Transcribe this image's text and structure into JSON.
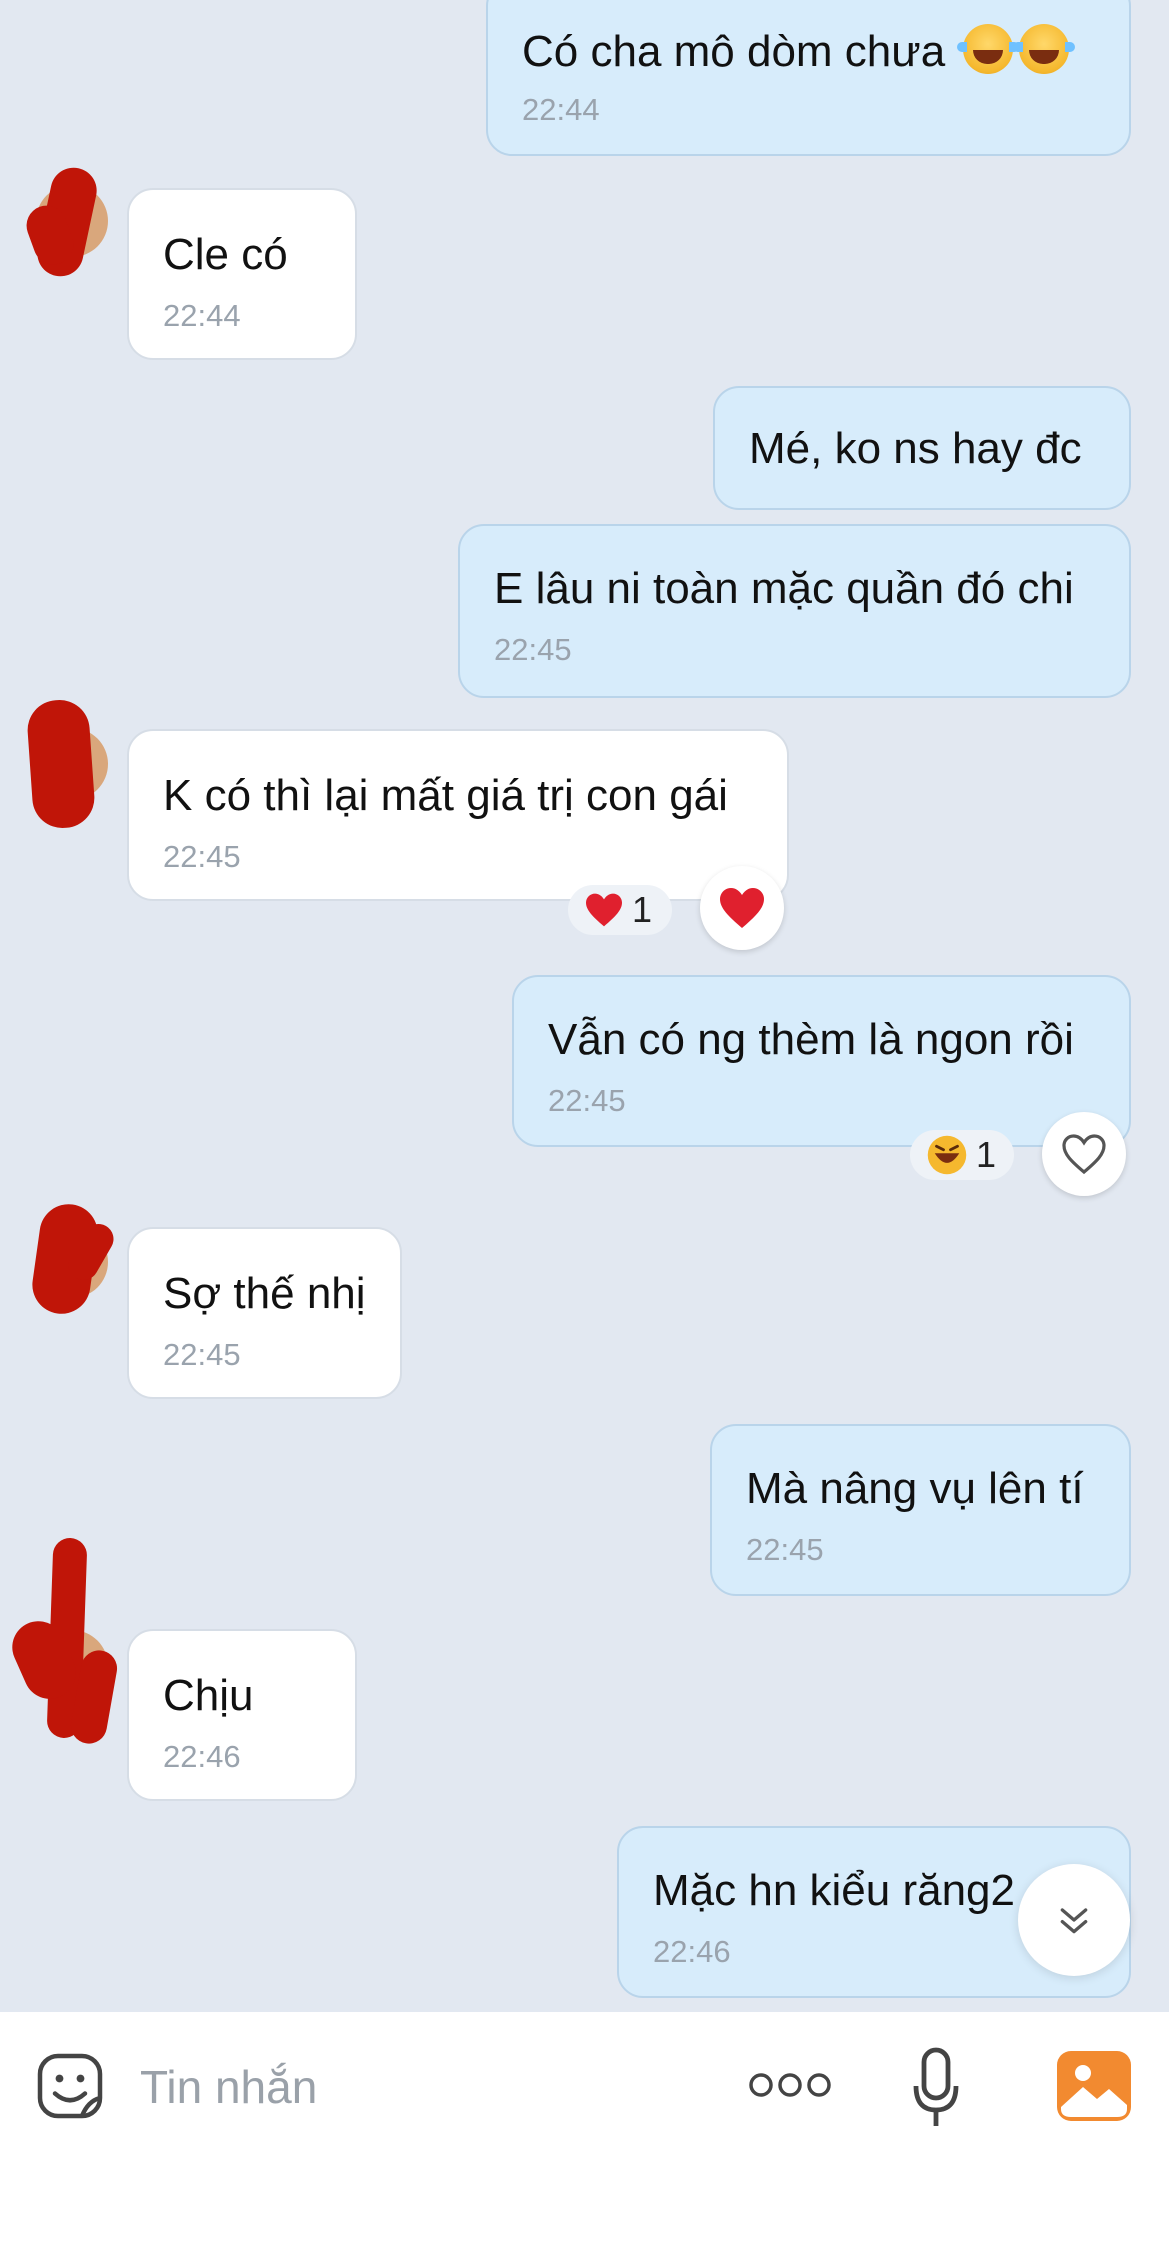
{
  "messages": [
    {
      "id": "m1",
      "side": "out",
      "text": "Có cha mô dòm chưa",
      "emoji_suffix": [
        "laughing-tears",
        "laughing-tears"
      ],
      "time": "22:44"
    },
    {
      "id": "m2",
      "side": "in",
      "text": "Cle có",
      "time": "22:44"
    },
    {
      "id": "m3",
      "side": "out",
      "text": "Mé, ko ns hay đc",
      "time": ""
    },
    {
      "id": "m4",
      "side": "out",
      "text": "E lâu ni toàn mặc quần đó chi",
      "time": "22:45"
    },
    {
      "id": "m5",
      "side": "in",
      "text": "K có thì lại mất giá trị con gái",
      "time": "22:45",
      "reaction": {
        "emoji": "red-heart",
        "count": "1"
      }
    },
    {
      "id": "m6",
      "side": "out",
      "text": "Vẫn có ng thèm là ngon rồi",
      "time": "22:45",
      "reaction": {
        "emoji": "laughing-face",
        "count": "1"
      }
    },
    {
      "id": "m7",
      "side": "in",
      "text": "Sợ thế nhị",
      "time": "22:45"
    },
    {
      "id": "m8",
      "side": "out",
      "text": "Mà nâng vụ lên tí",
      "time": "22:45"
    },
    {
      "id": "m9",
      "side": "in",
      "text": "Chịu",
      "time": "22:46"
    },
    {
      "id": "m10",
      "side": "out",
      "text": "Mặc hn kiểu răng2",
      "time": "22:46"
    }
  ],
  "composer": {
    "placeholder": "Tin nhắn",
    "value": "",
    "icons": [
      "sticker-icon",
      "more-icon",
      "microphone-icon",
      "image-icon"
    ]
  },
  "colors": {
    "background": "#e2e8f1",
    "outgoing_bubble": "#d7ecfb",
    "incoming_bubble": "#ffffff",
    "heart": "#e0202e",
    "image_icon": "#f28a30"
  }
}
